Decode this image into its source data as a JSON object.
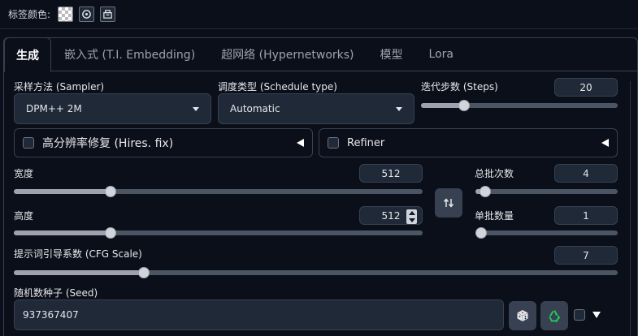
{
  "topbar": {
    "label": "标签颜色:"
  },
  "tabs": [
    {
      "label": "生成",
      "active": true
    },
    {
      "label": "嵌入式 (T.I. Embedding)"
    },
    {
      "label": "超网络 (Hypernetworks)"
    },
    {
      "label": "模型"
    },
    {
      "label": "Lora"
    }
  ],
  "sampler": {
    "label": "采样方法 (Sampler)",
    "value": "DPM++ 2M"
  },
  "schedule": {
    "label": "调度类型 (Schedule type)",
    "value": "Automatic"
  },
  "steps": {
    "label": "迭代步数 (Steps)",
    "value": "20",
    "fraction": 0.2
  },
  "hires": {
    "label": "高分辨率修复 (Hires. fix)"
  },
  "refiner": {
    "label": "Refiner"
  },
  "width": {
    "label": "宽度",
    "value": "512",
    "fraction": 0.23
  },
  "height": {
    "label": "高度",
    "value": "512",
    "fraction": 0.23
  },
  "batch_count": {
    "label": "总批次数",
    "value": "4",
    "fraction": 0.03
  },
  "batch_size": {
    "label": "单批数量",
    "value": "1",
    "fraction": 0.0
  },
  "cfg": {
    "label": "提示词引导系数 (CFG Scale)",
    "value": "7",
    "fraction": 0.21
  },
  "seed": {
    "label": "随机数种子 (Seed)",
    "value": "937367407"
  },
  "icons": {
    "swap": "swap-arrows-icon",
    "dice": "dice-icon",
    "recycle": "recycle-icon"
  },
  "colors": {
    "background": "#0b0f19",
    "input": "#1f2937",
    "border": "#374151",
    "recycle": "#22c55e"
  }
}
